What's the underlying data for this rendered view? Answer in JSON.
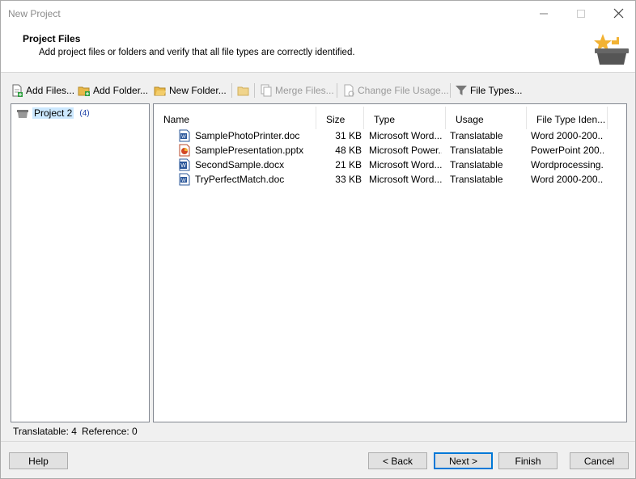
{
  "window": {
    "title": "New Project",
    "minimize_icon": "minimize-icon",
    "maximize_icon": "maximize-icon",
    "close_icon": "close-icon"
  },
  "header": {
    "title": "Project Files",
    "description": "Add project files or folders and verify that all file types are correctly identified."
  },
  "toolbar": {
    "add_files": "Add Files...",
    "add_folder": "Add Folder...",
    "new_folder": "New Folder...",
    "merge_files": "Merge Files...",
    "change_file_usage": "Change File Usage...",
    "file_types": "File Types..."
  },
  "tree": {
    "project_name": "Project 2",
    "project_count": "(4)"
  },
  "filelist": {
    "columns": [
      "Name",
      "Size",
      "Type",
      "Usage",
      "File Type Iden..."
    ],
    "rows": [
      {
        "name": "SamplePhotoPrinter.doc",
        "size": "31 KB",
        "type": "Microsoft Word...",
        "usage": "Translatable",
        "file_type": "Word  2000-200...",
        "icon": "doc"
      },
      {
        "name": "SamplePresentation.pptx",
        "size": "48 KB",
        "type": "Microsoft Power...",
        "usage": "Translatable",
        "file_type": "PowerPoint  200...",
        "icon": "pptx"
      },
      {
        "name": "SecondSample.docx",
        "size": "21 KB",
        "type": "Microsoft Word...",
        "usage": "Translatable",
        "file_type": "Wordprocessing...",
        "icon": "docx"
      },
      {
        "name": "TryPerfectMatch.doc",
        "size": "33 KB",
        "type": "Microsoft Word...",
        "usage": "Translatable",
        "file_type": "Word  2000-200...",
        "icon": "doc"
      }
    ]
  },
  "status": {
    "translatable": "Translatable: 4",
    "reference": "Reference: 0"
  },
  "footer": {
    "help": "Help",
    "back": "< Back",
    "next": "Next >",
    "finish": "Finish",
    "cancel": "Cancel"
  }
}
